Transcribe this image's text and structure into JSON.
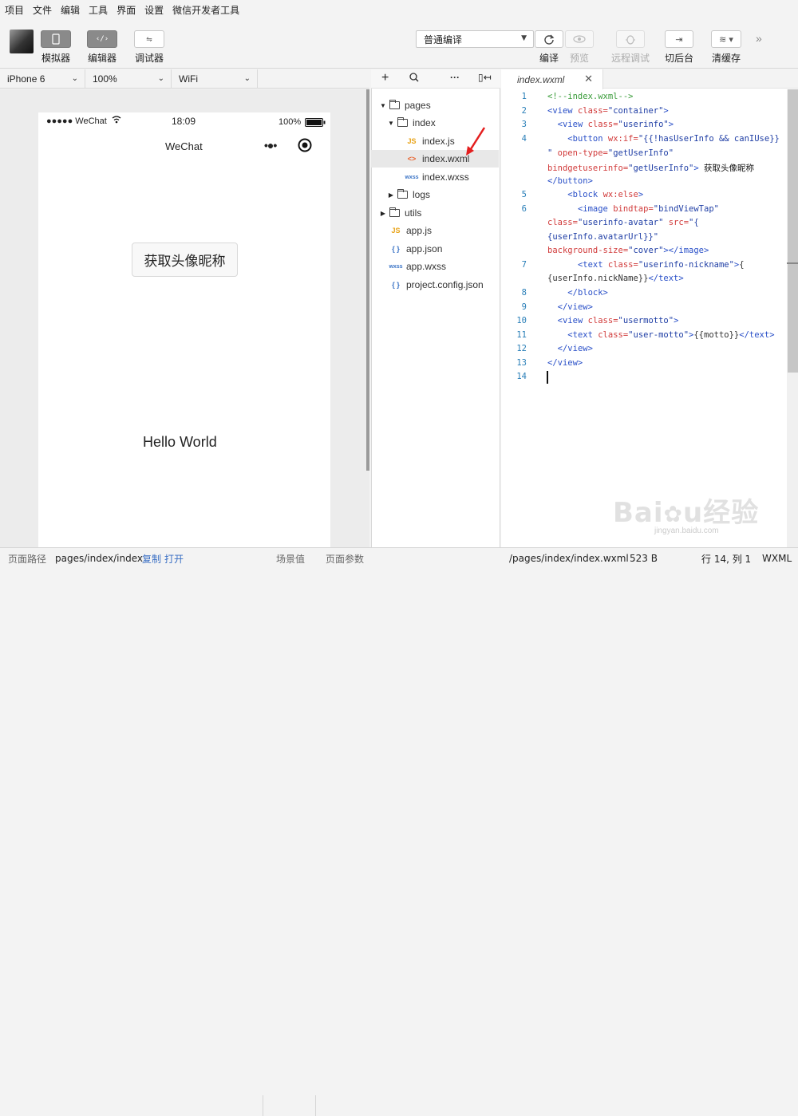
{
  "menubar": [
    "项目",
    "文件",
    "编辑",
    "工具",
    "界面",
    "设置",
    "微信开发者工具"
  ],
  "toolbar": {
    "simulator": "模拟器",
    "editor": "编辑器",
    "debugger": "调试器",
    "compile_mode": "普通编译",
    "compile": "编译",
    "preview": "预览",
    "remote_debug": "远程调试",
    "background": "切后台",
    "clear_cache": "清缓存"
  },
  "device_bar": {
    "device": "iPhone 6",
    "zoom": "100%",
    "network": "WiFi"
  },
  "phone": {
    "signal": "●●●●● WeChat",
    "time": "18:09",
    "battery": "100%",
    "nav_title": "WeChat",
    "button_label": "获取头像昵称",
    "motto": "Hello World"
  },
  "file_tree": {
    "items": [
      {
        "label": "pages",
        "type": "folder"
      },
      {
        "label": "index",
        "type": "folder"
      },
      {
        "label": "index.js",
        "type": "js"
      },
      {
        "label": "index.wxml",
        "type": "wxml"
      },
      {
        "label": "index.wxss",
        "type": "wxss"
      },
      {
        "label": "logs",
        "type": "folder"
      },
      {
        "label": "utils",
        "type": "folder"
      },
      {
        "label": "app.js",
        "type": "js"
      },
      {
        "label": "app.json",
        "type": "json"
      },
      {
        "label": "app.wxss",
        "type": "wxss"
      },
      {
        "label": "project.config.json",
        "type": "json"
      }
    ],
    "icon_labels": {
      "js": "JS",
      "wxml": "<>",
      "wxss": "wxss",
      "json": "{ }"
    }
  },
  "editor": {
    "tab_name": "index.wxml",
    "line_numbers": [
      "1",
      "2",
      "3",
      "4",
      "5",
      "6",
      "7",
      "8",
      "9",
      "10",
      "11",
      "12",
      "13",
      "14"
    ]
  },
  "bottombar": {
    "path_label": "页面路径",
    "path": "pages/index/index",
    "copy": "复制",
    "open": "打开",
    "scene": "场景值",
    "params": "页面参数",
    "file_path": "/pages/index/index.wxml",
    "size": "523 B",
    "cursor": "行 14, 列 1",
    "lang": "WXML"
  },
  "watermark": "Baidu经验 jingyan.baidu.com"
}
